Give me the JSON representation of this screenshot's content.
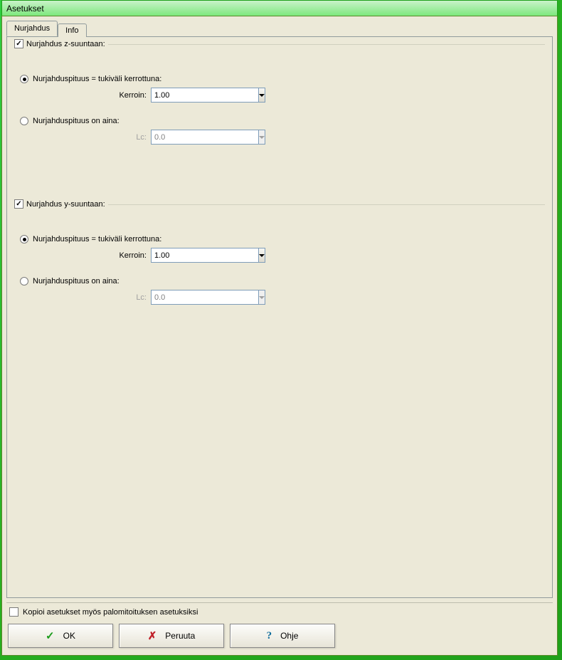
{
  "title": "Asetukset",
  "tabs": {
    "nurjahdus": "Nurjahdus",
    "info": "Info"
  },
  "z": {
    "legend": "Nurjahdus z-suuntaan:",
    "checked": true,
    "opt1": {
      "label": "Nurjahduspituus = tukiväli kerrottuna:",
      "selected": true
    },
    "kerroin_label": "Kerroin:",
    "kerroin_value": "1.00",
    "opt2": {
      "label": "Nurjahduspituus on aina:",
      "selected": false
    },
    "lc_label": "Lc:",
    "lc_value": "0.0"
  },
  "y": {
    "legend": "Nurjahdus y-suuntaan:",
    "checked": true,
    "opt1": {
      "label": "Nurjahduspituus = tukiväli kerrottuna:",
      "selected": true
    },
    "kerroin_label": "Kerroin:",
    "kerroin_value": "1.00",
    "opt2": {
      "label": "Nurjahduspituus on aina:",
      "selected": false
    },
    "lc_label": "Lc:",
    "lc_value": "0.0"
  },
  "copy_label": "Kopioi asetukset myös palomitoituksen asetuksiksi",
  "buttons": {
    "ok": "OK",
    "cancel": "Peruuta",
    "help": "Ohje"
  }
}
